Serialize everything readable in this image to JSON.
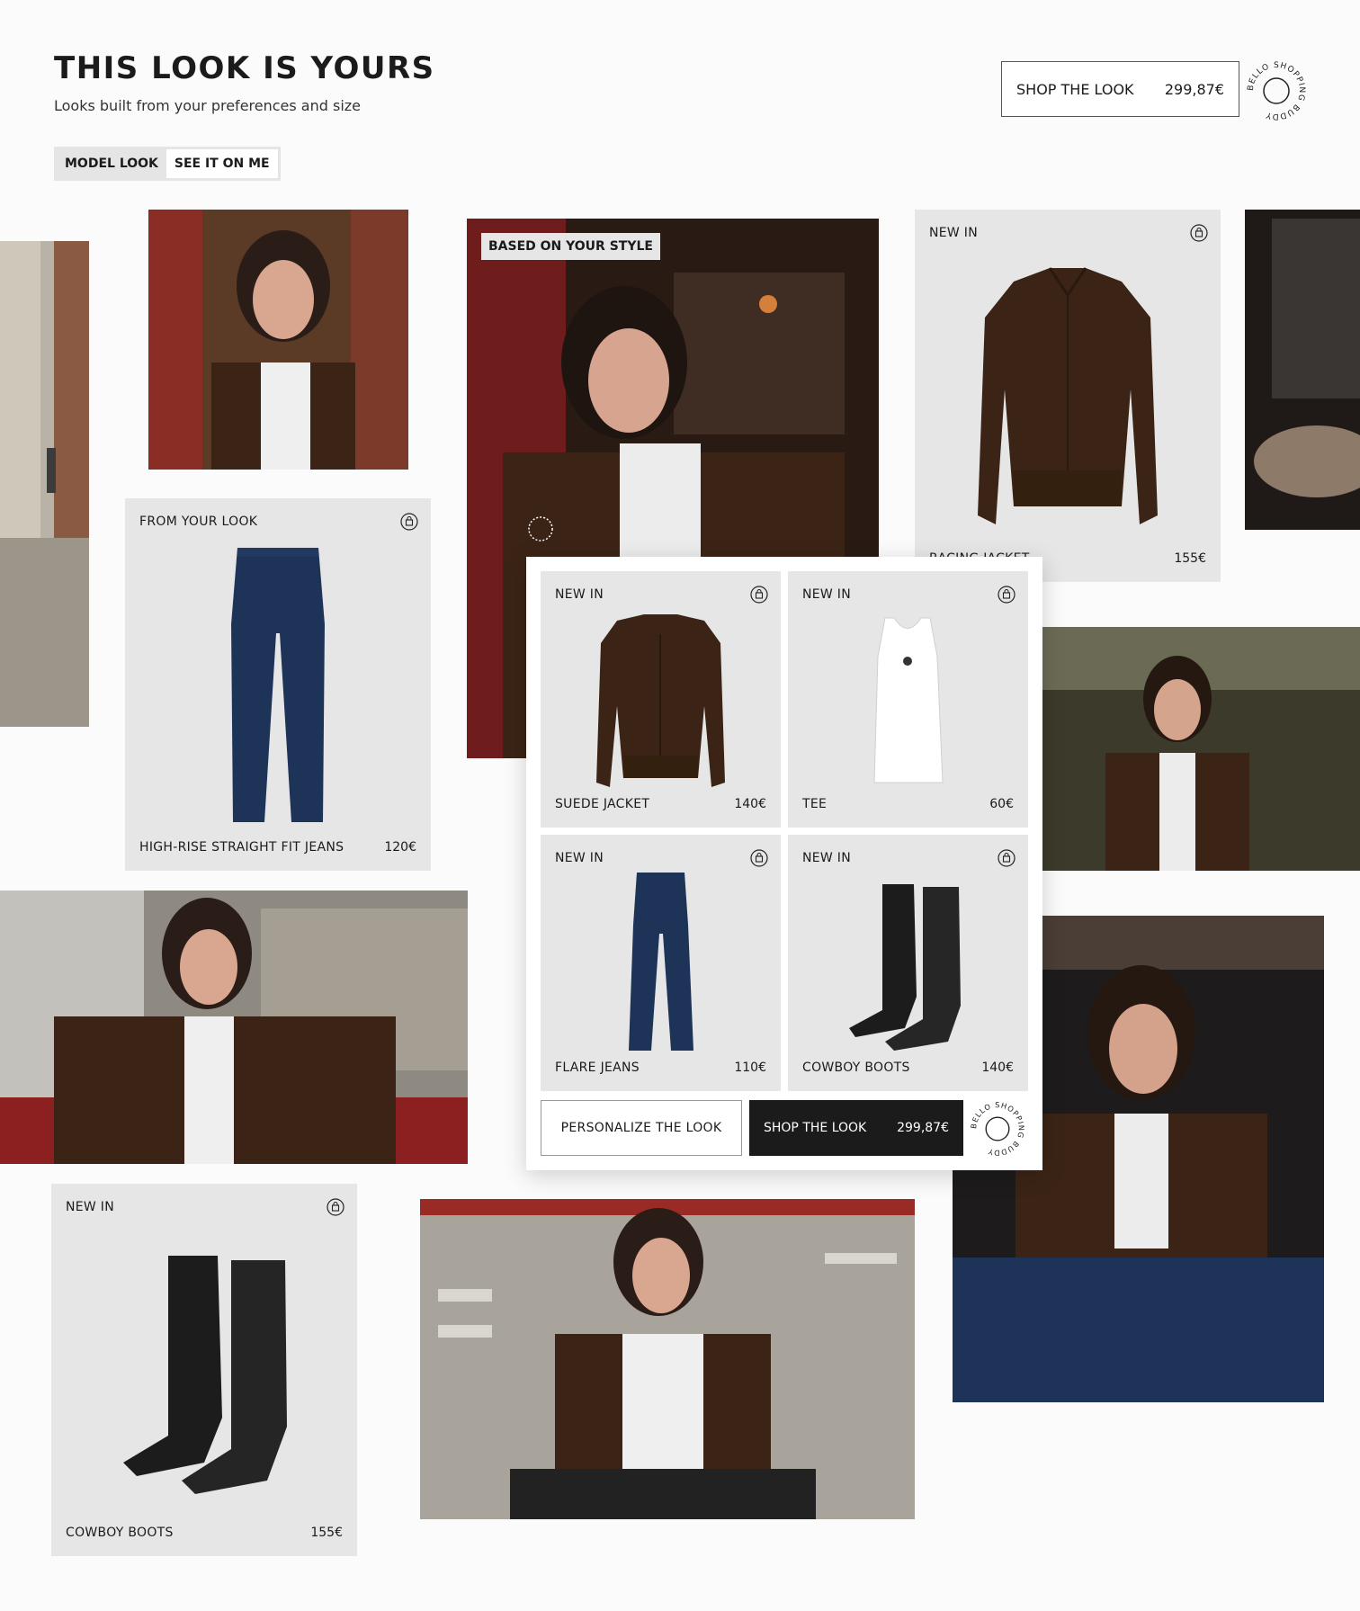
{
  "header": {
    "title": "THIS LOOK IS YOURS",
    "subtitle": "Looks built from your preferences and size",
    "toggle": {
      "option1": "MODEL LOOK",
      "option2": "SEE IT ON ME"
    },
    "shop_button": {
      "label": "SHOP THE LOOK",
      "price": "299,87€"
    },
    "badge_text": "BELLO SHOPPING BUDDY"
  },
  "featured": {
    "label": "BASED ON YOUR STYLE"
  },
  "cards": {
    "racing_jacket": {
      "tag": "NEW IN",
      "name": "RACING JACKET",
      "price": "155€"
    },
    "jeans_left": {
      "tag": "FROM YOUR LOOK",
      "name": "HIGH-RISE STRAIGHT FIT JEANS",
      "price": "120€"
    },
    "boots_left": {
      "tag": "NEW IN",
      "name": "COWBOY BOOTS",
      "price": "155€"
    }
  },
  "panel": {
    "items": [
      {
        "tag": "NEW IN",
        "name": "SUEDE JACKET",
        "price": "140€"
      },
      {
        "tag": "NEW IN",
        "name": "TEE",
        "price": "60€"
      },
      {
        "tag": "NEW IN",
        "name": "FLARE JEANS",
        "price": "110€"
      },
      {
        "tag": "NEW IN",
        "name": "COWBOY BOOTS",
        "price": "140€"
      }
    ],
    "personalize_label": "PERSONALIZE THE LOOK",
    "shop_label": "SHOP THE LOOK",
    "shop_price": "299,87€"
  },
  "colors": {
    "card_bg": "#e6e6e6",
    "suede_brown": "#3b2415",
    "denim": "#1e3358",
    "dark_button": "#1b1b1b"
  },
  "icons": [
    "shopping-bag-icon",
    "bello-badge-icon"
  ]
}
